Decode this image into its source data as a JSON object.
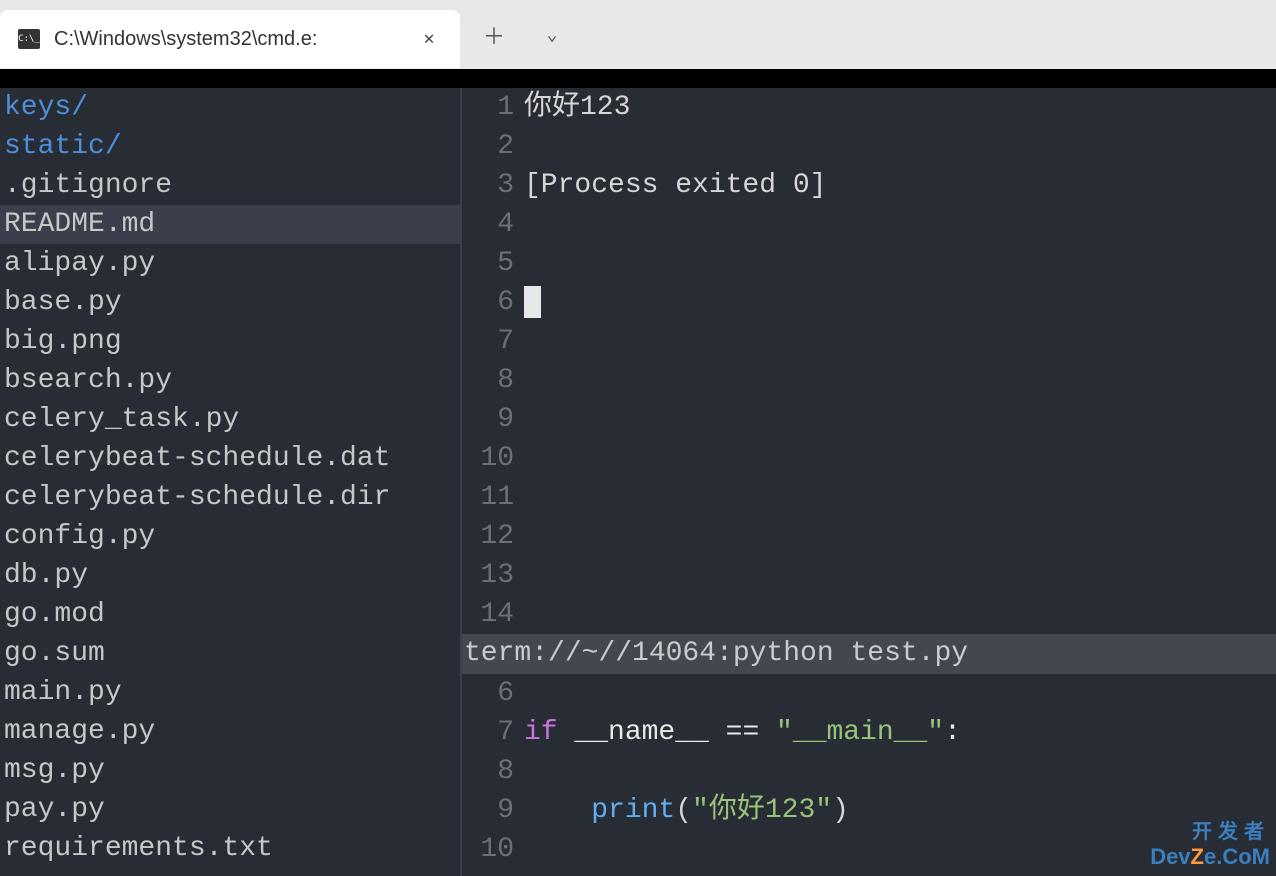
{
  "titlebar": {
    "tab_title": "C:\\Windows\\system32\\cmd.e:",
    "close_glyph": "✕",
    "plus_glyph": "＋",
    "chevron_glyph": "⌄"
  },
  "sidebar": {
    "items": [
      {
        "name": "keys/",
        "type": "dir"
      },
      {
        "name": "static/",
        "type": "dir"
      },
      {
        "name": ".gitignore",
        "type": "file"
      },
      {
        "name": "README.md",
        "type": "file",
        "selected": true
      },
      {
        "name": "alipay.py",
        "type": "file"
      },
      {
        "name": "base.py",
        "type": "file"
      },
      {
        "name": "big.png",
        "type": "file"
      },
      {
        "name": "bsearch.py",
        "type": "file"
      },
      {
        "name": "celery_task.py",
        "type": "file"
      },
      {
        "name": "celerybeat-schedule.dat",
        "type": "file"
      },
      {
        "name": "celerybeat-schedule.dir",
        "type": "file"
      },
      {
        "name": "config.py",
        "type": "file"
      },
      {
        "name": "db.py",
        "type": "file"
      },
      {
        "name": "go.mod",
        "type": "file"
      },
      {
        "name": "go.sum",
        "type": "file"
      },
      {
        "name": "main.py",
        "type": "file"
      },
      {
        "name": "manage.py",
        "type": "file"
      },
      {
        "name": "msg.py",
        "type": "file"
      },
      {
        "name": "pay.py",
        "type": "file"
      },
      {
        "name": "requirements.txt",
        "type": "file"
      }
    ]
  },
  "terminal_pane": {
    "lines": [
      {
        "n": "1",
        "text": "你好123"
      },
      {
        "n": "2",
        "text": ""
      },
      {
        "n": "3",
        "text": "[Process exited 0]"
      },
      {
        "n": "4",
        "text": ""
      },
      {
        "n": "5",
        "text": ""
      },
      {
        "n": "6",
        "text": "",
        "cursor": true
      },
      {
        "n": "7",
        "text": ""
      },
      {
        "n": "8",
        "text": ""
      },
      {
        "n": "9",
        "text": ""
      },
      {
        "n": "10",
        "text": ""
      },
      {
        "n": "11",
        "text": ""
      },
      {
        "n": "12",
        "text": ""
      },
      {
        "n": "13",
        "text": ""
      },
      {
        "n": "14",
        "text": ""
      }
    ],
    "status": "term://~//14064:python test.py"
  },
  "editor_pane": {
    "lines": [
      {
        "n": "6",
        "segments": []
      },
      {
        "n": "7",
        "segments": [
          {
            "t": "if",
            "cls": "kw"
          },
          {
            "t": " __name__ == ",
            "cls": "sp"
          },
          {
            "t": "\"__main__\"",
            "cls": "str"
          },
          {
            "t": ":",
            "cls": "sp"
          }
        ]
      },
      {
        "n": "8",
        "segments": []
      },
      {
        "n": "9",
        "segments": [
          {
            "t": "    ",
            "cls": "sp"
          },
          {
            "t": "print",
            "cls": "fn"
          },
          {
            "t": "(",
            "cls": "paren"
          },
          {
            "t": "\"你好123\"",
            "cls": "str"
          },
          {
            "t": ")",
            "cls": "paren"
          }
        ]
      },
      {
        "n": "10",
        "segments": []
      }
    ]
  },
  "watermark": {
    "top": "开发者",
    "bottom_dev": "Dev",
    "bottom_z": "Z",
    "bottom_com": "e.CoM"
  }
}
